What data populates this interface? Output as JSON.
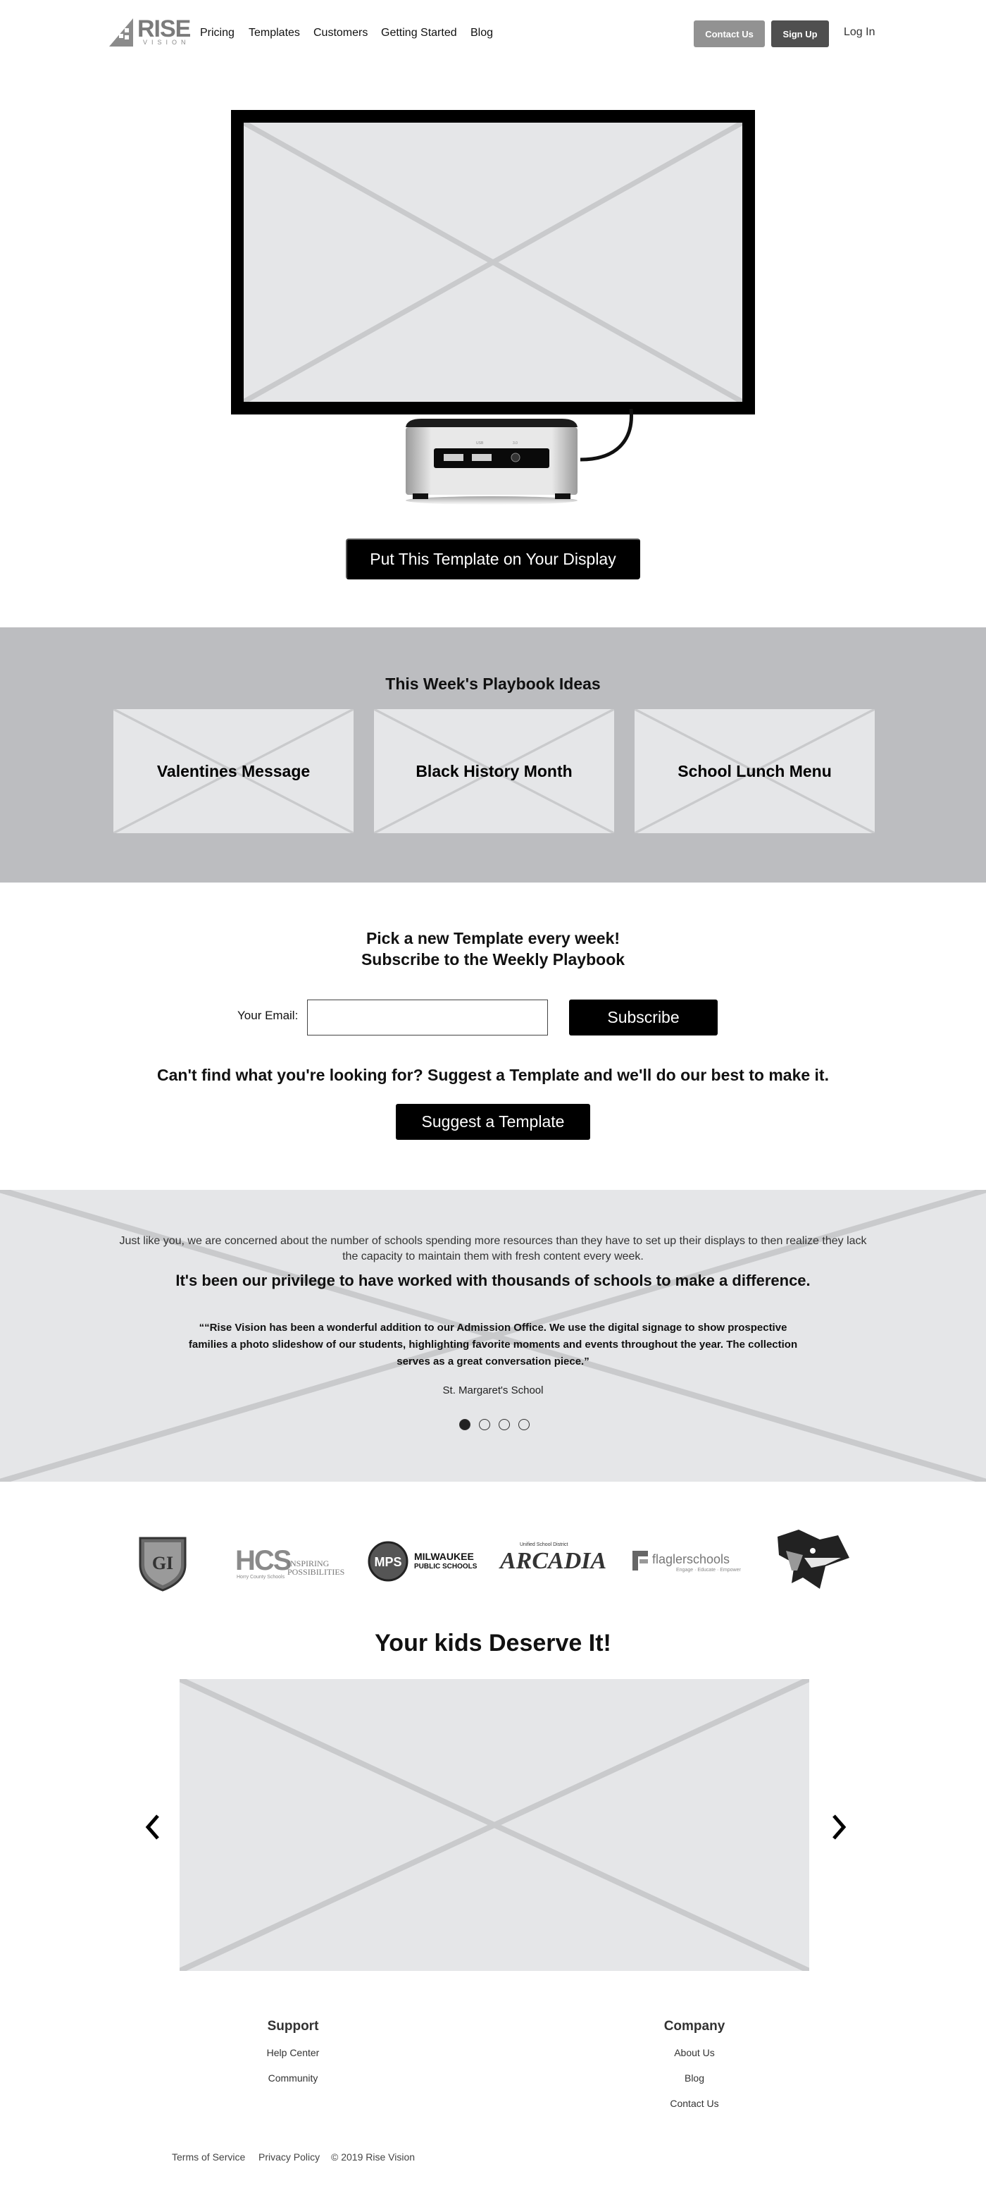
{
  "nav": {
    "logo_word": "RISE",
    "logo_sub": "VISION",
    "links": [
      "Pricing",
      "Templates",
      "Customers",
      "Getting Started",
      "Blog"
    ],
    "contact_label": "Contact Us",
    "signup_label": "Sign Up",
    "login_label": "Log In"
  },
  "hero": {
    "device_port_labels": [
      "USB",
      "3.0"
    ],
    "cta_label": "Put This Template on Your Display"
  },
  "playbook": {
    "title": "This Week's Playbook Ideas",
    "cards": [
      "Valentines Message",
      "Black History Month",
      "School Lunch Menu"
    ]
  },
  "subscribe": {
    "title_line1": "Pick a new Template every week!",
    "title_line2": "Subscribe to the Weekly Playbook",
    "email_label": "Your Email:",
    "email_value": "",
    "button_label": "Subscribe",
    "suggest_text": "Can't find what you're looking for? Suggest a Template and we'll do our best to make it.",
    "suggest_button": "Suggest a Template"
  },
  "testimonial": {
    "intro": "Just like you, we are concerned about the number of schools spending more resources than they have to set up their displays to then realize they lack the capacity to maintain them with fresh content every week.",
    "headline": "It's been our privilege to have worked with thousands of schools to make a difference.",
    "quote": "““Rise Vision has been a wonderful addition to our Admission Office. We use the digital signage to show prospective families a photo slideshow of our students, highlighting favorite moments and events throughout the year. The collection serves as a great conversation piece.”",
    "author": "St. Margaret's School",
    "slide_count": 4,
    "active_slide": 1
  },
  "logos": {
    "gi": "GI",
    "hcs": "HCS",
    "hcs_tag": "INSPIRING POSSIBILITIES",
    "hcs_small": "Horry County Schools",
    "mps": "MPS",
    "mps_line1": "MILWAUKEE",
    "mps_line2": "PUBLIC SCHOOLS",
    "arcadia_small": "Unified School District",
    "arcadia": "ARCADIA",
    "flagler": "flaglerschools",
    "flagler_tag": "Engage · Educate · Empower"
  },
  "kids": {
    "title": "Your kids Deserve It!"
  },
  "footer": {
    "support_title": "Support",
    "support_links": [
      "Help Center",
      "Community"
    ],
    "company_title": "Company",
    "company_links": [
      "About Us",
      "Blog",
      "Contact Us"
    ],
    "terms": "Terms of Service",
    "privacy": "Privacy Policy",
    "copyright": "© 2019 Rise Vision"
  },
  "colors": {
    "contact_button": "#929292",
    "signup_button": "#4f4f4f",
    "playbook_bg": "#bcbdc0",
    "placeholder": "#e5e6e8"
  }
}
